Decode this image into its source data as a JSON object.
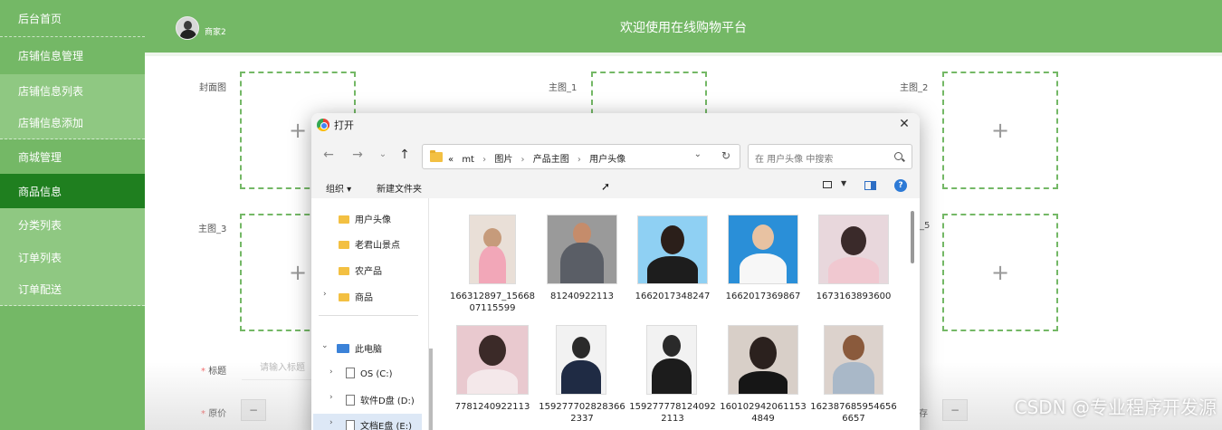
{
  "header": {
    "title": "欢迎使用在线购物平台",
    "username": "商家2"
  },
  "sidebar": {
    "items": [
      {
        "label": "后台首页"
      },
      {
        "label": "店铺信息管理"
      },
      {
        "label": "店铺信息列表"
      },
      {
        "label": "店铺信息添加"
      },
      {
        "label": "商城管理"
      },
      {
        "label": "商品信息"
      },
      {
        "label": "分类列表"
      },
      {
        "label": "订单列表"
      },
      {
        "label": "订单配送"
      }
    ]
  },
  "form": {
    "cover_label": "封面图",
    "main1_label": "主图_1",
    "main2_label": "主图_2",
    "main3_label": "主图_3",
    "main5_label_partial": "_5",
    "title_label": "标题",
    "title_placeholder": "请输入标题",
    "price_label": "原价",
    "minus": "−",
    "stock_partial": "存",
    "required_mark": "*",
    "plus": "+"
  },
  "dialog": {
    "title": "打开",
    "close": "✕",
    "breadcrumb": [
      "«",
      "mt",
      "图片",
      "产品主图",
      "用户头像"
    ],
    "search_placeholder": "在 用户头像 中搜索",
    "organize": "组织 ▾",
    "new_folder": "新建文件夹",
    "help": "?",
    "tree": [
      {
        "label": "用户头像"
      },
      {
        "label": "老君山景点"
      },
      {
        "label": "农产品"
      },
      {
        "label": "商品"
      },
      {
        "label": "此电脑"
      },
      {
        "label": "OS (C:)"
      },
      {
        "label": "软件D盘 (D:)"
      },
      {
        "label": "文档E盘 (E:)"
      }
    ],
    "files": [
      {
        "name": "166312897_1566807115599"
      },
      {
        "name": "81240922113"
      },
      {
        "name": "1662017348247"
      },
      {
        "name": "1662017369867"
      },
      {
        "name": "1673163893600"
      },
      {
        "name": "7781240922113"
      },
      {
        "name": "1592777028283662337"
      },
      {
        "name": "1592777781240922113"
      },
      {
        "name": "1601029420611534849"
      },
      {
        "name": "1623876859546566657"
      }
    ]
  },
  "watermark": "CSDN @专业程序开发源"
}
